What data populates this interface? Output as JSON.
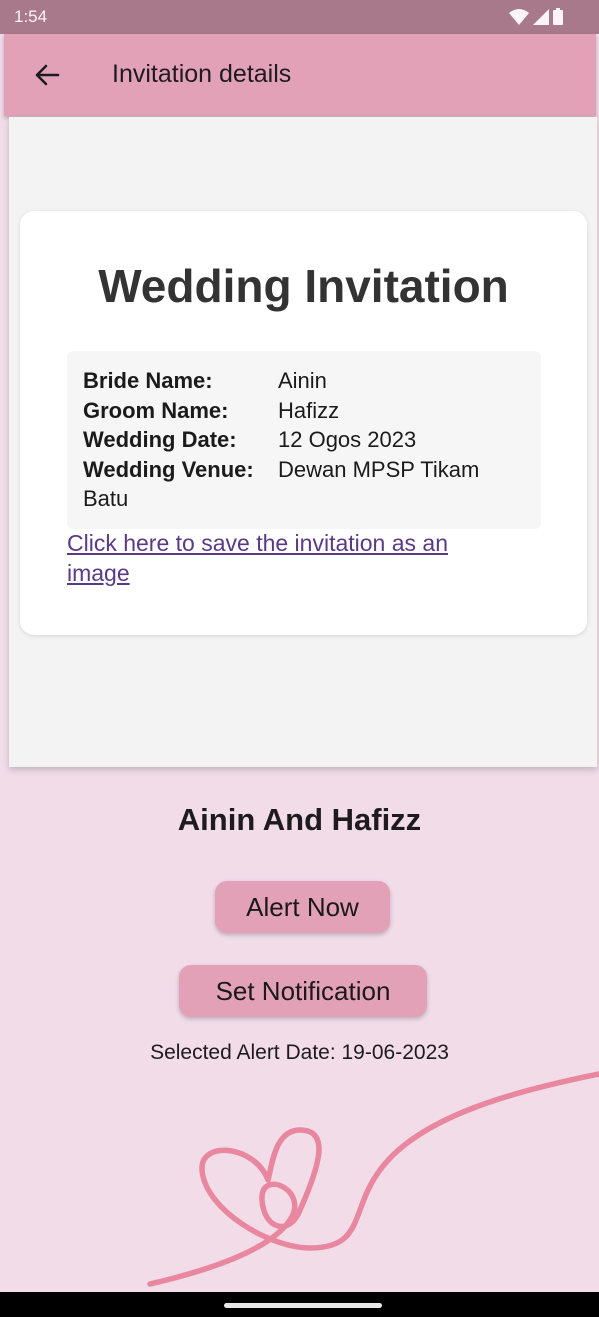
{
  "status_bar": {
    "time": "1:54"
  },
  "app_bar": {
    "title": "Invitation details",
    "back_icon": "arrow-left-icon"
  },
  "invitation": {
    "heading": "Wedding Invitation",
    "bride_label": "Bride Name:",
    "bride_value": "Ainin",
    "groom_label": "Groom Name:",
    "groom_value": "Hafizz",
    "date_label": "Wedding Date:",
    "date_value": "12 Ogos 2023",
    "venue_label": "Wedding Venue:",
    "venue_value": "Dewan MPSP Tikam",
    "venue_value_cont": "Batu",
    "save_link": "Click here to save the invitation as an image"
  },
  "main": {
    "couple_title": "Ainin And Hafizz",
    "alert_button": "Alert Now",
    "notification_button": "Set Notification",
    "selected_alert_date": "Selected Alert Date: 19-06-2023"
  },
  "colors": {
    "app_bar": "#e3a1b8",
    "page_background": "#f1dce8",
    "link": "#5a3a86",
    "heart_line": "#e8879f"
  }
}
